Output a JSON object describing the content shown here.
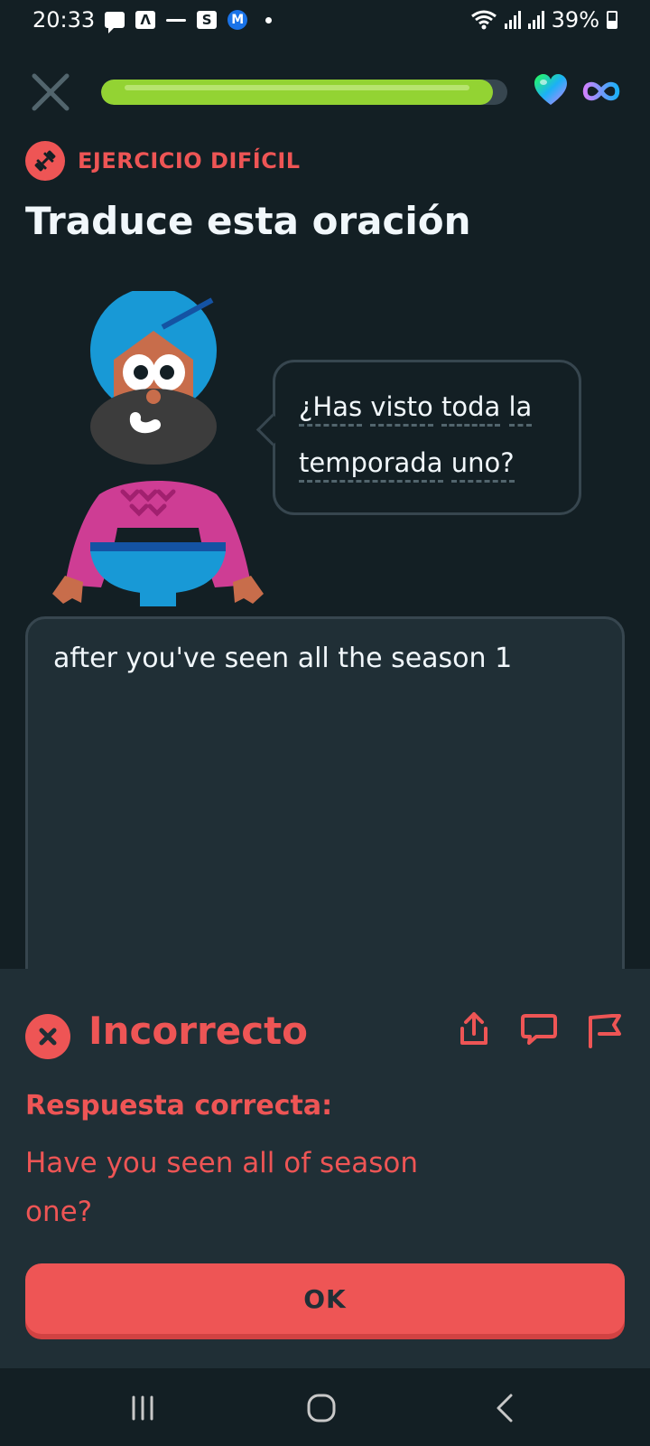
{
  "status_bar": {
    "time": "20:33",
    "battery": "39%",
    "notification_icons": [
      "chat-icon",
      "a-app-icon",
      "news-icon",
      "s-app-icon",
      "m-app-icon",
      "dot-icon"
    ],
    "s_icon_letter": "S",
    "m_icon_letter": "M",
    "a_icon_letter": "Λ"
  },
  "header": {
    "progress_fraction": 0.965,
    "hearts": "infinite",
    "colors": {
      "progress": "#93d333",
      "track": "#37464f"
    }
  },
  "exercise": {
    "badge_label": "EJERCICIO DIFÍCIL",
    "title": "Traduce esta oración",
    "prompt_words": [
      "¿Has",
      "visto",
      "toda",
      "la",
      "temporada",
      "uno?"
    ],
    "user_answer": "after you've seen all the season 1"
  },
  "feedback": {
    "title": "Incorrecto",
    "correct_label": "Respuesta correcta:",
    "correct_answer": "Have you seen all of season one?",
    "ok_label": "OK",
    "colors": {
      "error": "#ee5555",
      "panel": "#202f36"
    }
  },
  "nav": {
    "icons": [
      "recent-apps-icon",
      "home-icon",
      "back-icon"
    ]
  }
}
